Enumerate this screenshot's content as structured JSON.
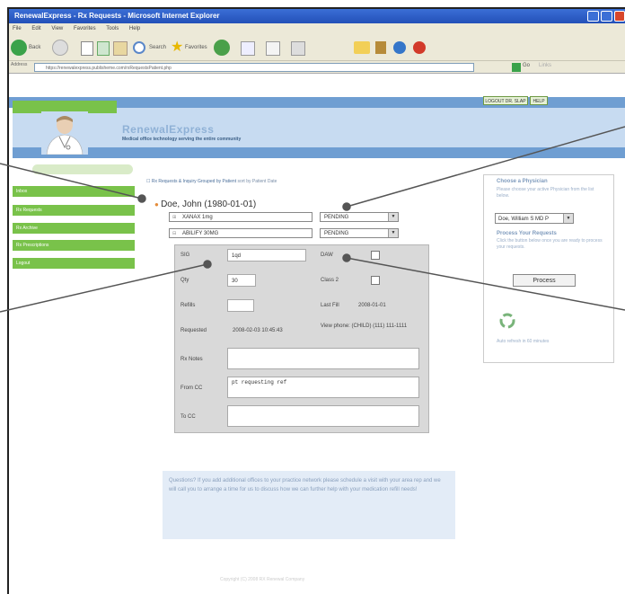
{
  "browser": {
    "title": "RenewalExpress - Rx Requests - Microsoft Internet Explorer",
    "menu": [
      "File",
      "Edit",
      "View",
      "Favorites",
      "Tools",
      "Help"
    ],
    "toolbar": {
      "back": "Back",
      "search": "Search",
      "favorites": "Favorites"
    },
    "address": "https://renewalexpress.publisheme.com/rxRequestsPatient.php",
    "go": "Go",
    "links": "Links"
  },
  "header": {
    "logo": "RenewalExpress",
    "tagline": "Medical office technology serving the entire community",
    "logout": "LOGOUT DR. SLAP",
    "help": "HELP"
  },
  "nav": {
    "items": [
      "Inbox",
      "Rx Requests",
      "Rx Archive",
      "Rx Prescriptions",
      "Logout"
    ]
  },
  "main": {
    "breadcrumb": "Rx Requests & Inquiry Grouped by Patient",
    "breadcrumb_sort": "sort by Patient Date",
    "patient": "Doe, John (1980-01-01)",
    "meds": [
      {
        "name": "XANAX 1mg",
        "status": "PENDING"
      },
      {
        "name": "ABILIFY 30MG",
        "status": "PENDING"
      }
    ]
  },
  "rx": {
    "sig_label": "SIG",
    "sig_value": "1qd",
    "daw_label": "DAW",
    "qty_label": "Qty",
    "qty_value": "30",
    "class2_label": "Class 2",
    "refills_label": "Refills",
    "refills_value": "",
    "lastfill_label": "Last Fill",
    "lastfill_value": "2008-01-01",
    "requested_label": "Requested",
    "requested_value": "2008-02-03 10:45:43",
    "view_phone": "View phone: (CHILD) (111) 111-1111",
    "rxnotes_label": "Rx Notes",
    "fromcc_label": "From CC",
    "fromcc_value": "pt requesting ref",
    "tocc_label": "To CC"
  },
  "right": {
    "choose_title": "Choose a Physician",
    "choose_text": "Please choose your active Physician from the list below.",
    "physician": "Doe, William S MD P",
    "process_title": "Process Your Requests",
    "process_text": "Click the button below once you are ready to process your requests.",
    "process_button": "Process",
    "refresh_note": "Auto refresh in 60 minutes"
  },
  "footer": {
    "info": "Questions? If you add additional offices to your practice network please schedule a visit with your area rep and we will call you to arrange a time for us to discuss how we can further help with your medication refill needs!",
    "copyright": "Copyright (C) 2008 RX Renewal Company"
  },
  "colors": {
    "nav_green": "#79c24a",
    "header_blue": "#6f9ed2",
    "banner_blue": "#c7dbf1",
    "status_orange": "#e48c3a"
  }
}
